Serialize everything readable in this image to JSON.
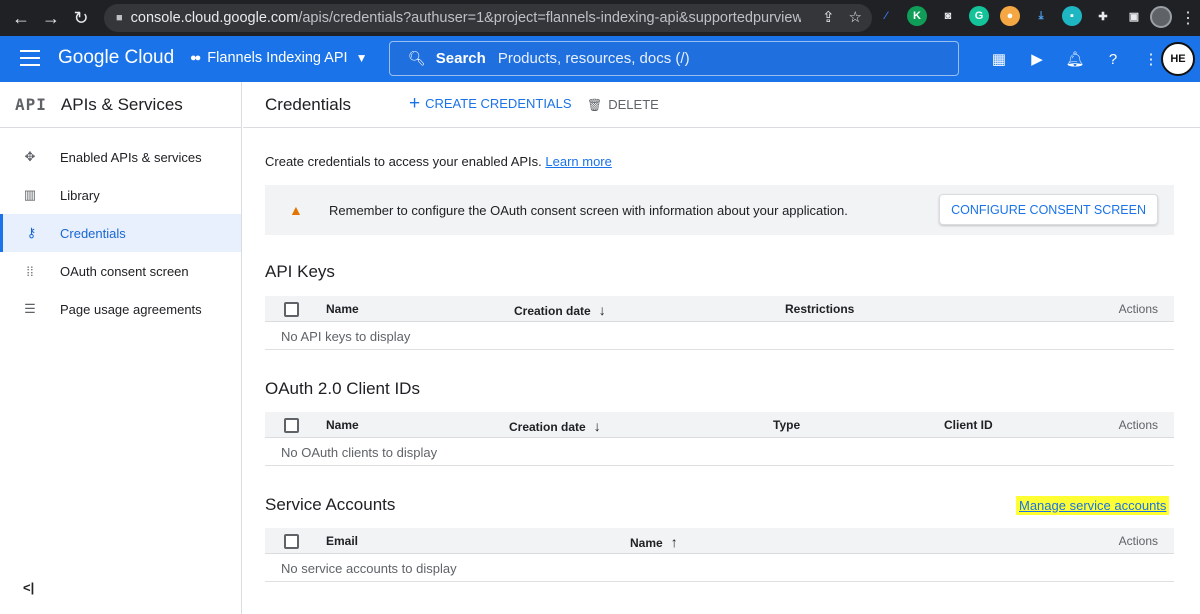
{
  "browser": {
    "url_host": "console.cloud.google.com",
    "url_path": "/apis/credentials?authuser=1&project=flannels-indexing-api&supportedpurview=proj..."
  },
  "header": {
    "brand": "Google Cloud",
    "project": "Flannels Indexing API",
    "search_label": "Search",
    "search_placeholder": "Products, resources, docs (/)",
    "avatar_text": "HE",
    "colors": {
      "header": "#1a73e8",
      "accent": "#1a73e8"
    }
  },
  "sidebar": {
    "badge": "API",
    "title": "APIs & Services",
    "items": [
      {
        "label": "Enabled APIs & services",
        "icon": "network-icon"
      },
      {
        "label": "Library",
        "icon": "library-icon"
      },
      {
        "label": "Credentials",
        "icon": "key-icon",
        "active": true
      },
      {
        "label": "OAuth consent screen",
        "icon": "dots-grid-icon"
      },
      {
        "label": "Page usage agreements",
        "icon": "settings-list-icon"
      }
    ],
    "collapse_label": "<|"
  },
  "toolbar": {
    "title": "Credentials",
    "create_label": "CREATE CREDENTIALS",
    "delete_label": "DELETE"
  },
  "intro": {
    "text": "Create credentials to access your enabled APIs.",
    "link": "Learn more"
  },
  "banner": {
    "message": "Remember to configure the OAuth consent screen with information about your application.",
    "button": "CONFIGURE CONSENT SCREEN"
  },
  "api_keys": {
    "title": "API Keys",
    "columns": [
      "Name",
      "Creation date",
      "Restrictions",
      "Actions"
    ],
    "empty": "No API keys to display"
  },
  "oauth": {
    "title": "OAuth 2.0 Client IDs",
    "columns": [
      "Name",
      "Creation date",
      "Type",
      "Client ID",
      "Actions"
    ],
    "empty": "No OAuth clients to display"
  },
  "service_accounts": {
    "title": "Service Accounts",
    "manage_link": "Manage service accounts",
    "columns": [
      "Email",
      "Name",
      "Actions"
    ],
    "empty": "No service accounts to display"
  }
}
